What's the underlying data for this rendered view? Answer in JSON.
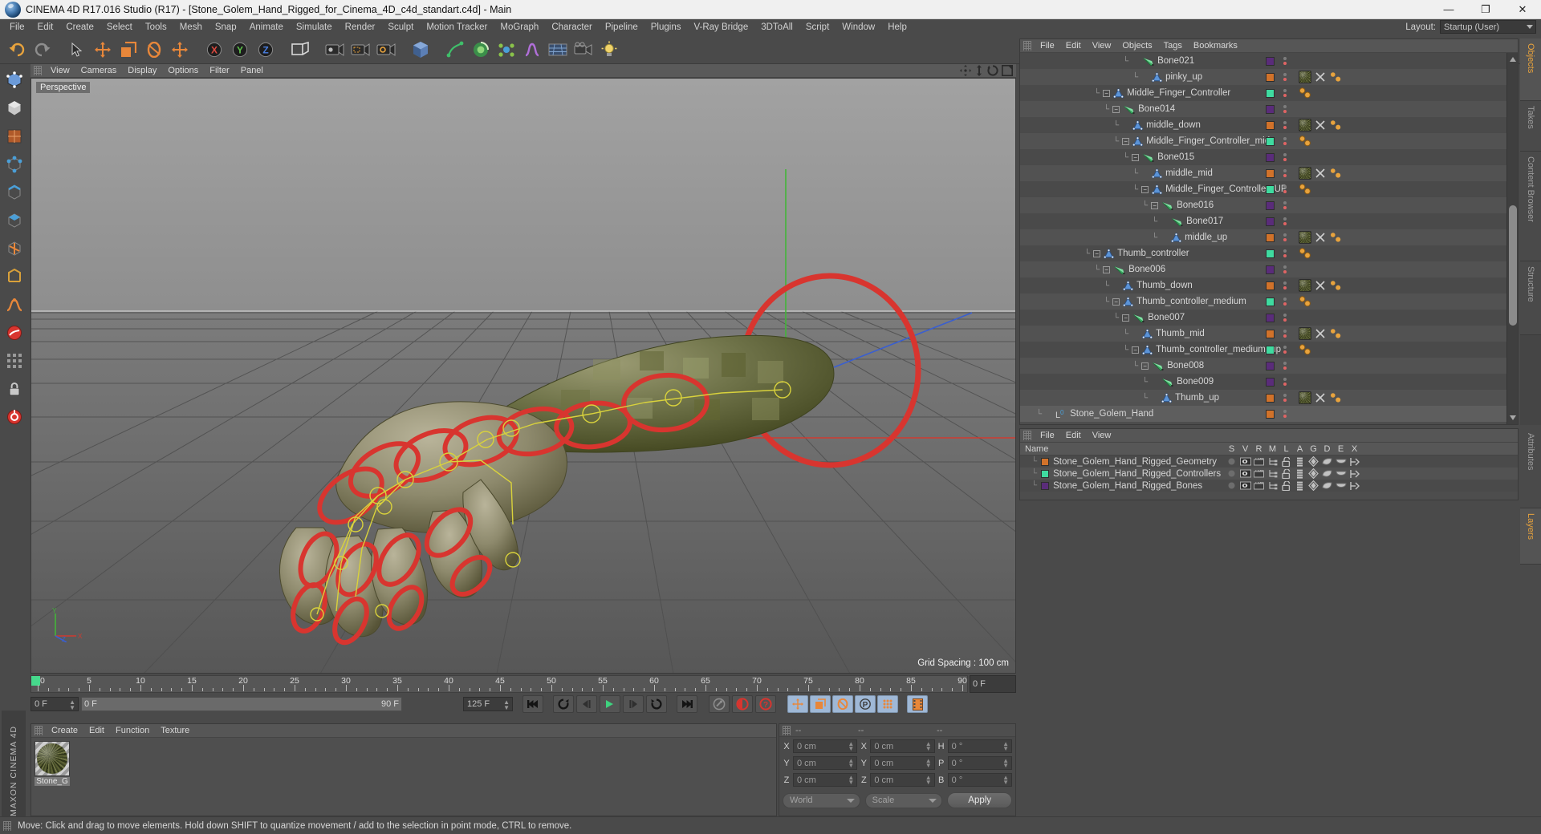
{
  "window": {
    "title": "CINEMA 4D R17.016 Studio (R17) - [Stone_Golem_Hand_Rigged_for_Cinema_4D_c4d_standart.c4d] - Main",
    "minimize": "—",
    "maximize": "❐",
    "close": "✕"
  },
  "menubar": {
    "items": [
      "File",
      "Edit",
      "Create",
      "Select",
      "Tools",
      "Mesh",
      "Snap",
      "Animate",
      "Simulate",
      "Render",
      "Sculpt",
      "Motion Tracker",
      "MoGraph",
      "Character",
      "Pipeline",
      "Plugins",
      "V-Ray Bridge",
      "3DToAll",
      "Script",
      "Window",
      "Help"
    ],
    "layout_label": "Layout:",
    "layout_value": "Startup (User)"
  },
  "toolbar": {
    "buttons": [
      {
        "name": "undo-button",
        "icon": "undo"
      },
      {
        "name": "redo-button",
        "icon": "redo"
      },
      {
        "name": "live-selection-button",
        "icon": "cursor"
      },
      {
        "name": "move-button",
        "icon": "move"
      },
      {
        "name": "scale-button",
        "icon": "scale"
      },
      {
        "name": "rotate-button",
        "icon": "rotate"
      },
      {
        "name": "move-alt-button",
        "icon": "move2"
      },
      {
        "name": "lock-x-button",
        "icon": "x"
      },
      {
        "name": "lock-y-button",
        "icon": "y"
      },
      {
        "name": "lock-z-button",
        "icon": "z"
      },
      {
        "name": "world-object-coord-button",
        "icon": "world"
      },
      {
        "name": "render-view-button",
        "icon": "renderview"
      },
      {
        "name": "render-region-button",
        "icon": "renderregion"
      },
      {
        "name": "render-settings-button",
        "icon": "rendersettings"
      },
      {
        "name": "cube-primitive-button",
        "icon": "cube"
      },
      {
        "name": "spline-pen-button",
        "icon": "pen"
      },
      {
        "name": "nurbs-button",
        "icon": "nurbs"
      },
      {
        "name": "array-button",
        "icon": "array"
      },
      {
        "name": "deformer-button",
        "icon": "deformer"
      },
      {
        "name": "environment-button",
        "icon": "floor"
      },
      {
        "name": "camera-button",
        "icon": "camera"
      },
      {
        "name": "light-button",
        "icon": "light"
      }
    ]
  },
  "left_tools": [
    {
      "name": "make-editable-button",
      "icon": "editable"
    },
    {
      "name": "model-mode-button",
      "icon": "model"
    },
    {
      "name": "texture-mode-button",
      "icon": "texture"
    },
    {
      "name": "points-mode-button",
      "icon": "points"
    },
    {
      "name": "edges-mode-button",
      "icon": "edges"
    },
    {
      "name": "polygons-mode-button",
      "icon": "polygons"
    },
    {
      "name": "axis-mode-button",
      "icon": "axis"
    },
    {
      "name": "object-axis-button",
      "icon": "objaxis"
    },
    {
      "name": "soft-selection-button",
      "icon": "soft"
    },
    {
      "name": "workplane-button",
      "icon": "workplane"
    },
    {
      "name": "enable-snap-button",
      "icon": "snap"
    },
    {
      "name": "lock-workplane-button",
      "icon": "lockwp"
    },
    {
      "name": "viewport-solo-button",
      "icon": "solo"
    }
  ],
  "left_brand": "MAXON CINEMA 4D",
  "viewport": {
    "menu": [
      "View",
      "Cameras",
      "Display",
      "Options",
      "Filter",
      "Panel"
    ],
    "label": "Perspective",
    "grid_spacing": "Grid Spacing : 100 cm",
    "axis_labels": {
      "x": "X",
      "y": "Y",
      "z": "Z"
    }
  },
  "timeline": {
    "ticks": [
      0,
      5,
      10,
      15,
      20,
      25,
      30,
      35,
      40,
      45,
      50,
      55,
      60,
      65,
      70,
      75,
      80,
      85,
      90
    ],
    "start": 0,
    "end": 90,
    "current_frame_right": "0 F",
    "current_frame_left": "0 F",
    "range_start": "0 F",
    "range_end": "90 F",
    "max_frames": "125 F"
  },
  "playback": {
    "go_to_start": "go-to-start",
    "prev_key": "prev-keyframe",
    "prev_frame": "prev-frame",
    "play": "play",
    "next_frame": "next-frame",
    "next_key": "next-keyframe",
    "go_to_end": "go-to-end",
    "autokey": "autokeying",
    "record": "record-active-objects",
    "keyframe_selection": "keyframe-selection"
  },
  "material_manager": {
    "menu": [
      "Create",
      "Edit",
      "Function",
      "Texture"
    ],
    "materials": [
      {
        "name": "Stone_G"
      }
    ]
  },
  "coordinates": {
    "headers": [
      "--",
      "--",
      "--"
    ],
    "rows": [
      {
        "axis1": "X",
        "val1": "0 cm",
        "axis2": "X",
        "val2": "0 cm",
        "axis3": "H",
        "val3": "0 °"
      },
      {
        "axis1": "Y",
        "val1": "0 cm",
        "axis2": "Y",
        "val2": "0 cm",
        "axis3": "P",
        "val3": "0 °"
      },
      {
        "axis1": "Z",
        "val1": "0 cm",
        "axis2": "Z",
        "val2": "0 cm",
        "axis3": "B",
        "val3": "0 °"
      }
    ],
    "system": "World",
    "mode": "Scale",
    "apply": "Apply"
  },
  "object_manager": {
    "menu": [
      "File",
      "Edit",
      "View",
      "Objects",
      "Tags",
      "Bookmarks"
    ],
    "rows": [
      {
        "label": "Bone021",
        "indent": 10,
        "type": "bone",
        "expander": "none",
        "chip": "#5a2c7a",
        "tags": []
      },
      {
        "label": "pinky_up",
        "indent": 11,
        "type": "joint",
        "expander": "none",
        "chip": "#d1722a",
        "tags": [
          "mat",
          "x",
          "y"
        ]
      },
      {
        "label": "Middle_Finger_Controller",
        "indent": 7,
        "type": "joint",
        "expander": "minus",
        "chip": "#3fdba0",
        "tags": [
          "ball"
        ]
      },
      {
        "label": "Bone014",
        "indent": 8,
        "type": "bone",
        "expander": "minus",
        "chip": "#5a2c7a",
        "tags": []
      },
      {
        "label": "middle_down",
        "indent": 9,
        "type": "joint",
        "expander": "none",
        "chip": "#d1722a",
        "tags": [
          "mat",
          "x",
          "y"
        ]
      },
      {
        "label": "Middle_Finger_Controller_mid",
        "indent": 9,
        "type": "joint",
        "expander": "minus",
        "chip": "#3fdba0",
        "tags": [
          "ball"
        ]
      },
      {
        "label": "Bone015",
        "indent": 10,
        "type": "bone",
        "expander": "minus",
        "chip": "#5a2c7a",
        "tags": []
      },
      {
        "label": "middle_mid",
        "indent": 11,
        "type": "joint",
        "expander": "none",
        "chip": "#d1722a",
        "tags": [
          "mat",
          "x",
          "y"
        ]
      },
      {
        "label": "Middle_Finger_Controller_UP",
        "indent": 11,
        "type": "joint",
        "expander": "minus",
        "chip": "#3fdba0",
        "tags": [
          "ball"
        ]
      },
      {
        "label": "Bone016",
        "indent": 12,
        "type": "bone",
        "expander": "minus",
        "chip": "#5a2c7a",
        "tags": []
      },
      {
        "label": "Bone017",
        "indent": 13,
        "type": "bone",
        "expander": "none",
        "chip": "#5a2c7a",
        "tags": []
      },
      {
        "label": "middle_up",
        "indent": 13,
        "type": "joint",
        "expander": "none",
        "chip": "#d1722a",
        "tags": [
          "mat",
          "x",
          "y"
        ]
      },
      {
        "label": "Thumb_controller",
        "indent": 6,
        "type": "joint",
        "expander": "minus",
        "chip": "#3fdba0",
        "tags": [
          "ball"
        ]
      },
      {
        "label": "Bone006",
        "indent": 7,
        "type": "bone",
        "expander": "minus",
        "chip": "#5a2c7a",
        "tags": []
      },
      {
        "label": "Thumb_down",
        "indent": 8,
        "type": "joint",
        "expander": "none",
        "chip": "#d1722a",
        "tags": [
          "mat",
          "x",
          "y"
        ]
      },
      {
        "label": "Thumb_controller_medium",
        "indent": 8,
        "type": "joint",
        "expander": "minus",
        "chip": "#3fdba0",
        "tags": [
          "ball"
        ]
      },
      {
        "label": "Bone007",
        "indent": 9,
        "type": "bone",
        "expander": "minus",
        "chip": "#5a2c7a",
        "tags": []
      },
      {
        "label": "Thumb_mid",
        "indent": 10,
        "type": "joint",
        "expander": "none",
        "chip": "#d1722a",
        "tags": [
          "mat",
          "x",
          "y"
        ]
      },
      {
        "label": "Thumb_controller_medium_up",
        "indent": 10,
        "type": "joint",
        "expander": "minus",
        "chip": "#3fdba0",
        "tags": [
          "ball"
        ]
      },
      {
        "label": "Bone008",
        "indent": 11,
        "type": "bone",
        "expander": "minus",
        "chip": "#5a2c7a",
        "tags": []
      },
      {
        "label": "Bone009",
        "indent": 12,
        "type": "bone",
        "expander": "none",
        "chip": "#5a2c7a",
        "tags": []
      },
      {
        "label": "Thumb_up",
        "indent": 12,
        "type": "joint",
        "expander": "none",
        "chip": "#d1722a",
        "tags": [
          "mat",
          "x",
          "y"
        ]
      },
      {
        "label": "Stone_Golem_Hand",
        "indent": 1,
        "type": "layer0",
        "expander": "none",
        "chip": "#d1722a",
        "tags": []
      }
    ]
  },
  "layer_manager": {
    "menu": [
      "File",
      "Edit",
      "View"
    ],
    "columns": [
      "Name",
      "S",
      "V",
      "R",
      "M",
      "L",
      "A",
      "G",
      "D",
      "E",
      "X"
    ],
    "rows": [
      {
        "label": "Stone_Golem_Hand_Rigged_Geometry",
        "color": "#d1722a"
      },
      {
        "label": "Stone_Golem_Hand_Rigged_Controllers",
        "color": "#3fdba0"
      },
      {
        "label": "Stone_Golem_Hand_Rigged_Bones",
        "color": "#5a2c7a"
      }
    ]
  },
  "right_tabs_top": [
    {
      "label": "Objects",
      "active": true
    },
    {
      "label": "Takes",
      "active": false
    },
    {
      "label": "Content Browser",
      "active": false
    },
    {
      "label": "Structure",
      "active": false
    }
  ],
  "right_tabs_bottom": [
    {
      "label": "Attributes",
      "active": false
    },
    {
      "label": "Layers",
      "active": true
    }
  ],
  "statusbar": {
    "text": "Move: Click and drag to move elements. Hold down SHIFT to quantize movement / add to the selection in point mode, CTRL to remove."
  },
  "colors": {
    "accent_orange": "#e8a33d",
    "joint_blue": "#5b93d6",
    "bone_green": "#3fbf6a",
    "controller_green": "#3fdba0",
    "geometry_orange": "#d1722a",
    "bones_purple": "#5a2c7a",
    "rig_red": "#d8352f",
    "selection_yellow": "#d9d23c"
  }
}
